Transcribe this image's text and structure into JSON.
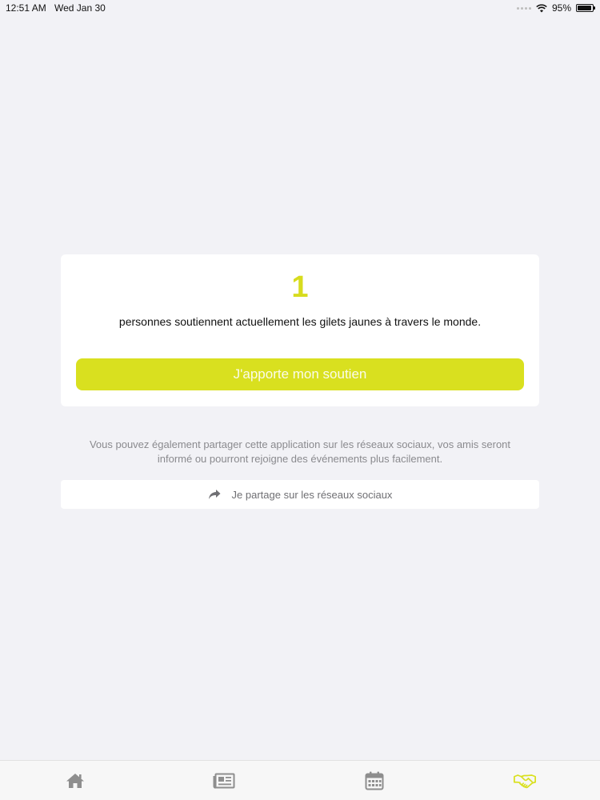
{
  "status_bar": {
    "time": "12:51 AM",
    "date": "Wed Jan 30",
    "battery": "95%",
    "battery_level": 0.95
  },
  "support_card": {
    "count": "1",
    "description": "personnes soutiennent actuellement les gilets jaunes à travers le monde.",
    "button_label": "J'apporte mon soutien"
  },
  "share": {
    "info_line1": "Vous pouvez également partager cette application sur les réseaux sociaux, vos amis seront",
    "info_line2": "informé ou pourront rejoigne des événements plus facilement.",
    "button_label": "Je partage sur les réseaux sociaux",
    "icon": "share-arrow-icon"
  },
  "tab_bar": {
    "tabs": [
      {
        "icon": "home-icon",
        "active": false
      },
      {
        "icon": "newspaper-icon",
        "active": false
      },
      {
        "icon": "calendar-icon",
        "active": false
      },
      {
        "icon": "handshake-icon",
        "active": true
      }
    ]
  },
  "colors": {
    "accent": "#d9e01f",
    "background": "#f2f2f6",
    "inactive_icon": "#8e8e8e"
  }
}
